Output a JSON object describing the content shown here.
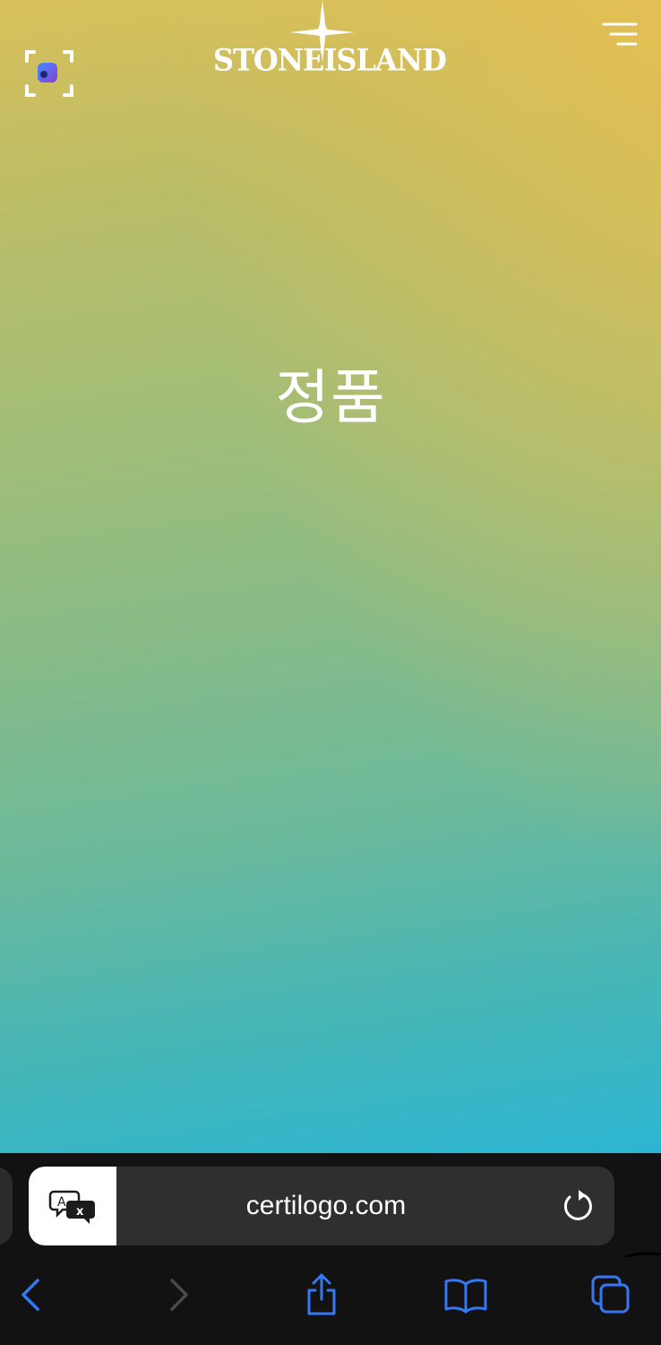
{
  "brand": {
    "name_left": "STONE",
    "name_right": "ISLAND",
    "logo_color": "#ffffff"
  },
  "page": {
    "headline": "정품"
  },
  "browser": {
    "url": "certilogo.com",
    "translate_icon": "translate-icon",
    "reload_icon": "reload-icon",
    "toolbar": {
      "back_icon": "chevron-left-icon",
      "forward_icon": "chevron-right-icon",
      "share_icon": "share-icon",
      "bookmarks_icon": "book-icon",
      "tabs_icon": "tabs-icon"
    },
    "accent_color": "#3478f6"
  },
  "icons": {
    "scan": "scan-icon",
    "menu": "menu-icon"
  }
}
